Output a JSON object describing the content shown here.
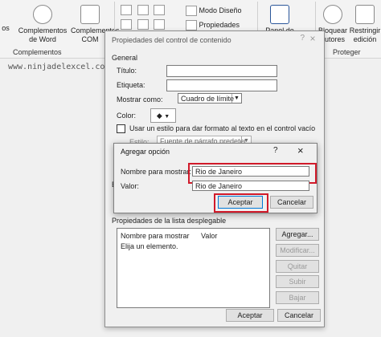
{
  "ribbon": {
    "items": [
      {
        "label": "os"
      },
      {
        "label": "Complementos de Word"
      },
      {
        "label": "Complementos COM"
      },
      {
        "label": "Modo Diseño"
      },
      {
        "label": "Propiedades"
      },
      {
        "label": "Panel de"
      },
      {
        "label": "Bloquear autores"
      },
      {
        "label": "Restringir edición"
      }
    ],
    "group_complementos": "Complementos",
    "group_proteger": "Proteger"
  },
  "watermark": "www.ninjadelexcel.com",
  "properties_dialog": {
    "title": "Propiedades del control de contenido",
    "help": "?",
    "close": "×",
    "section_general": "General",
    "titulo_label": "Título:",
    "etiqueta_label": "Etiqueta:",
    "mostrar_como_label": "Mostrar como:",
    "mostrar_como_value": "Cuadro de límite",
    "color_label": "Color:",
    "usar_estilo_label": "Usar un estilo para dar formato al texto en el control vacío",
    "estilo_label": "Estilo:",
    "estilo_value": "Fuente de párrafo predeter.",
    "bloqueo_partial": "Bl",
    "section_lista": "Propiedades de la lista desplegable",
    "list_columns": [
      "Nombre para mostrar",
      "Valor"
    ],
    "list_items": [
      "Elija un elemento."
    ],
    "side_buttons": [
      "Agregar...",
      "Modificar...",
      "Quitar",
      "Subir",
      "Bajar"
    ],
    "aceptar": "Aceptar",
    "cancelar": "Cancelar"
  },
  "add_dialog": {
    "title": "Agregar opción",
    "help": "?",
    "close": "×",
    "nombre_label": "Nombre para mostrar:",
    "nombre_value": "Rio de Janeiro",
    "valor_label": "Valor:",
    "valor_value": "Rio de Janeiro",
    "aceptar": "Aceptar",
    "cancelar": "Cancelar"
  },
  "colors": {
    "highlight_red": "#d11a2a",
    "button_focus": "#0078d7"
  }
}
